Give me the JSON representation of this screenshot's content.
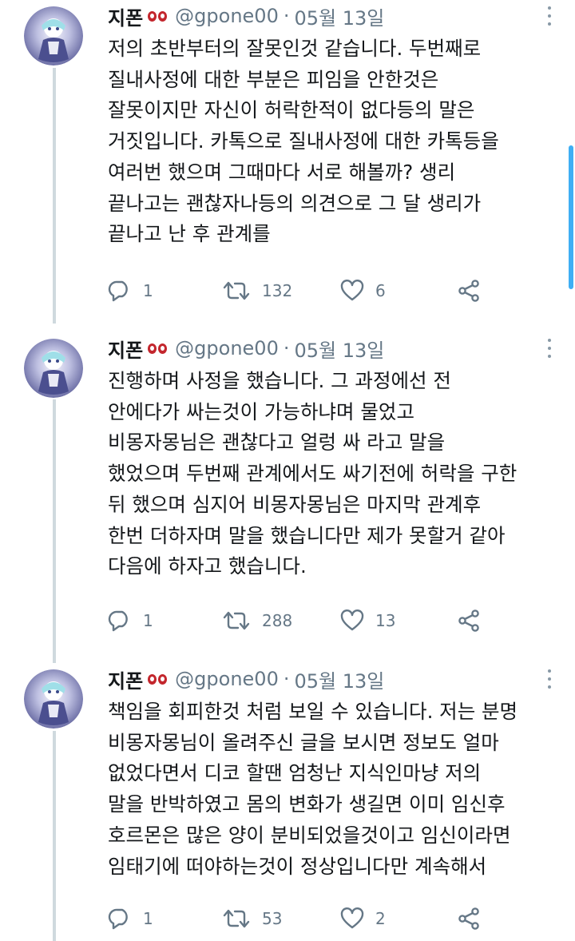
{
  "tweets": [
    {
      "display_name": "지폰",
      "handle": "@gpone00",
      "separator": "·",
      "date": "05월 13일",
      "body": "저의 초반부터의 잘못인것 같습니다. 두번째로\n질내사정에 대한 부분은 피임을 안한것은\n잘못이지만 자신이 허락한적이 없다등의 말은\n거짓입니다. 카톡으로 질내사정에 대한 카톡등을\n여러번 했으며 그때마다 서로 해볼까? 생리\n끝나고는 괜찮자나등의 의견으로 그 달 생리가\n끝나고 난 후 관계를",
      "reply_count": "1",
      "retweet_count": "132",
      "like_count": "6"
    },
    {
      "display_name": "지폰",
      "handle": "@gpone00",
      "separator": "·",
      "date": "05월 13일",
      "body": "진행하며 사정을 했습니다. 그 과정에선 전\n안에다가 싸는것이 가능하냐며 물었고\n비몽자몽님은 괜찮다고 얼렁 싸 라고 말을\n했었으며 두번째 관계에서도 싸기전에 허락을 구한\n뒤 했으며 심지어 비몽자몽님은 마지막 관계후\n한번 더하자며 말을 했습니다만 제가 못할거 같아\n다음에 하자고 했습니다.",
      "reply_count": "1",
      "retweet_count": "288",
      "like_count": "13"
    },
    {
      "display_name": "지폰",
      "handle": "@gpone00",
      "separator": "·",
      "date": "05월 13일",
      "body": "책임을 회피한것 처럼 보일 수 있습니다. 저는 분명\n비몽자몽님이 올려주신 글을 보시면 정보도 얼마\n없었다면서 디코 할땐 엄청난 지식인마냥 저의\n말을 반박하였고 몸의 변화가 생길면 이미 임신후\n호르몬은 많은 양이 분비되었을것이고 임신이라면\n임태기에 떠야하는것이 정상입니다만 계속해서",
      "reply_count": "1",
      "retweet_count": "53",
      "like_count": "2"
    }
  ],
  "icons": {
    "reply": "reply-icon",
    "retweet": "retweet-icon",
    "like": "heart-icon",
    "share": "share-icon",
    "more": "more-options-icon",
    "name_emoji": "eyes-emoji-icon"
  },
  "colors": {
    "text": "#14171a",
    "muted": "#657786",
    "thread_line": "#cfd9de",
    "scrollbar": "#1da1f2",
    "emoji": "#c3262d"
  }
}
